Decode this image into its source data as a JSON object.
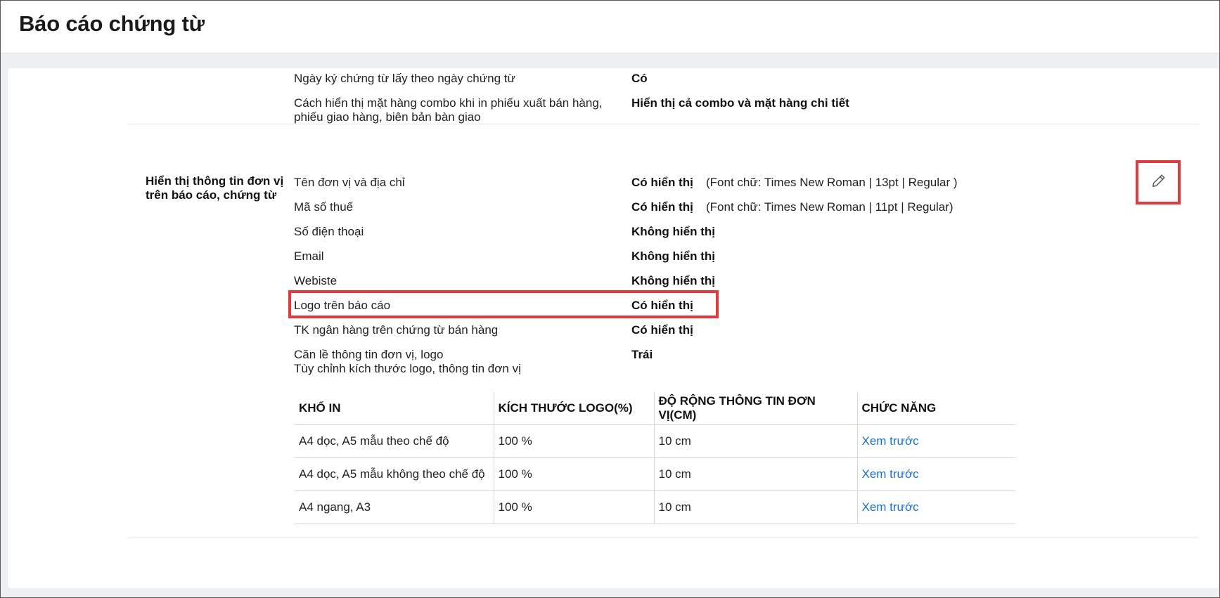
{
  "page": {
    "title": "Báo cáo chứng từ"
  },
  "top_settings": [
    {
      "label": "Ngày ký chứng từ lấy theo ngày chứng từ",
      "value": "Có"
    },
    {
      "label_line1": "Cách hiển thị mặt hàng combo khi in phiếu xuất bán hàng,",
      "label_line2": "phiếu giao hàng, biên bản bàn giao",
      "value": "Hiển thị cả combo và mặt hàng chi tiết"
    }
  ],
  "unit_info": {
    "section_title_line1": "Hiển thị thông tin đơn vị",
    "section_title_line2": "trên báo cáo, chứng từ",
    "rows": [
      {
        "label": "Tên đơn vị và địa chỉ",
        "value": "Có hiển thị",
        "note": "(Font chữ: Times New Roman | 13pt | Regular )"
      },
      {
        "label": "Mã số thuế",
        "value": "Có hiển thị",
        "note": "(Font chữ: Times New Roman | 11pt | Regular)"
      },
      {
        "label": "Số điện thoại",
        "value": "Không hiển thị"
      },
      {
        "label": "Email",
        "value": "Không hiển thị"
      },
      {
        "label": "Webiste",
        "value": "Không hiển thị"
      },
      {
        "label": "Logo trên báo cáo",
        "value": "Có hiển thị"
      },
      {
        "label": "TK ngân hàng trên chứng từ bán hàng",
        "value": "Có hiển thị"
      },
      {
        "label": "Căn lề thông tin đơn vị, logo",
        "value": "Trái"
      }
    ],
    "custom_size_label": "Tùy chỉnh kích thước logo, thông tin đơn vị",
    "edit_icon": "pencil-icon"
  },
  "table": {
    "headers": [
      "KHỔ IN",
      "KÍCH THƯỚC LOGO(%)",
      "ĐỘ RỘNG THÔNG TIN ĐƠN VỊ(CM)",
      "CHỨC NĂNG"
    ],
    "rows": [
      {
        "paper": "A4 dọc, A5 mẫu theo chế độ",
        "logo_size": "100 %",
        "width": "10 cm",
        "action": "Xem trước"
      },
      {
        "paper": "A4 dọc, A5 mẫu không theo chế độ",
        "logo_size": "100 %",
        "width": "10 cm",
        "action": "Xem trước"
      },
      {
        "paper": "A4 ngang, A3",
        "logo_size": "100 %",
        "width": "10 cm",
        "action": "Xem trước"
      }
    ]
  },
  "colors": {
    "highlight": "#e03a3e",
    "link": "#1673c6",
    "background": "#eeeff1"
  }
}
